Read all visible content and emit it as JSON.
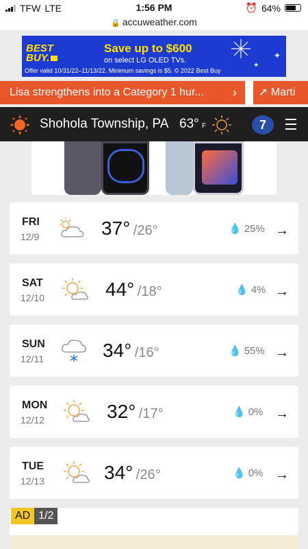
{
  "status": {
    "carrier": "TFW",
    "network": "LTE",
    "time": "1:56 PM",
    "battery": "64%"
  },
  "browser": {
    "url": "accuweather.com"
  },
  "top_ad": {
    "brand_line1": "BEST",
    "brand_line2": "BUY.",
    "headline": "Save up to $600",
    "sub": "on select LG OLED TVs.",
    "fine_print": "Offer valid 10/31/22–11/13/22. Minimum savings is $5. © 2022 Best Buy"
  },
  "news": {
    "headline": "Lisa strengthens into a Category 1 hur...",
    "next_headline": "Marti",
    "accent": "#e8572a"
  },
  "header": {
    "location": "Shohola Township, PA",
    "temp": "63°",
    "unit": "F",
    "station": "7"
  },
  "forecast": [
    {
      "dow": "FRI",
      "date": "12/9",
      "hi": "37°",
      "lo": "/26°",
      "precip": "25%",
      "icon": "partly-cloudy-icon"
    },
    {
      "dow": "SAT",
      "date": "12/10",
      "hi": "44°",
      "lo": "/18°",
      "precip": "4%",
      "icon": "sun-cloud-icon"
    },
    {
      "dow": "SUN",
      "date": "12/11",
      "hi": "34°",
      "lo": "/16°",
      "precip": "55%",
      "icon": "snow-cloud-icon"
    },
    {
      "dow": "MON",
      "date": "12/12",
      "hi": "32°",
      "lo": "/17°",
      "precip": "0%",
      "icon": "sun-cloud-icon"
    },
    {
      "dow": "TUE",
      "date": "12/13",
      "hi": "34°",
      "lo": "/26°",
      "precip": "0%",
      "icon": "sun-cloud-icon"
    }
  ],
  "ad_label": {
    "ad": "AD",
    "page": "1/2"
  }
}
